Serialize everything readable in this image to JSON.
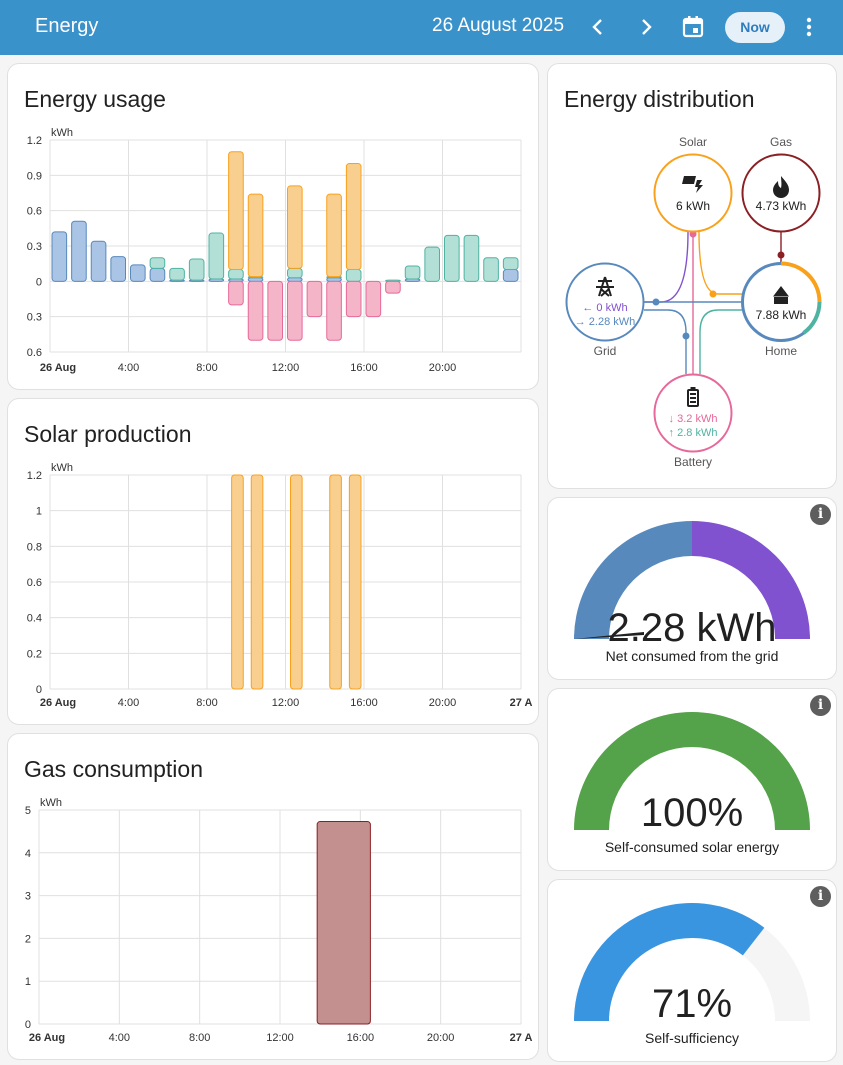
{
  "header": {
    "title": "Energy",
    "date": "26 August 2025",
    "now_label": "Now",
    "icons": [
      "chevron-left-icon",
      "chevron-right-icon",
      "calendar-icon",
      "more-vert-icon"
    ]
  },
  "energy_usage": {
    "title": "Energy usage",
    "unit": "kWh",
    "y_ticks": [
      "1.2",
      "0.9",
      "0.6",
      "0.3",
      "0",
      "0.3",
      "0.6"
    ],
    "x_ticks": [
      "26 Aug",
      "4:00",
      "8:00",
      "12:00",
      "16:00",
      "20:00"
    ]
  },
  "solar_production": {
    "title": "Solar production",
    "unit": "kWh",
    "y_ticks": [
      "1.2",
      "1",
      "0.8",
      "0.6",
      "0.4",
      "0.2",
      "0"
    ],
    "x_ticks": [
      "26 Aug",
      "4:00",
      "8:00",
      "12:00",
      "16:00",
      "20:00",
      "27 A"
    ]
  },
  "gas_consumption": {
    "title": "Gas consumption",
    "unit": "kWh",
    "y_ticks": [
      "5",
      "4",
      "3",
      "2",
      "1",
      "0"
    ],
    "x_ticks": [
      "26 Aug",
      "4:00",
      "8:00",
      "12:00",
      "16:00",
      "20:00",
      "27 A"
    ]
  },
  "distribution": {
    "title": "Energy distribution",
    "solar": {
      "label": "Solar",
      "value": "6 kWh"
    },
    "gas": {
      "label": "Gas",
      "value": "4.73 kWh"
    },
    "grid": {
      "label": "Grid",
      "in": "← 0 kWh",
      "out": "→ 2.28 kWh"
    },
    "home": {
      "label": "Home",
      "value": "7.88 kWh"
    },
    "battery": {
      "label": "Battery",
      "in": "↓ 3.2 kWh",
      "out": "↑ 2.8 kWh"
    }
  },
  "gauges": {
    "grid": {
      "value": "2.28 kWh",
      "label": "Net consumed from the grid"
    },
    "solar": {
      "value": "100%",
      "label": "Self-consumed solar energy",
      "fraction": 1.0
    },
    "self_sufficiency": {
      "value": "71%",
      "label": "Self-sufficiency",
      "fraction": 0.71
    }
  },
  "colors": {
    "header": "#3a92cb",
    "grid_consumption": "#a9c4e4",
    "solar": "#f9cf8f",
    "battery_out": "#b2e0d6",
    "battery_in": "#f4b5c8",
    "gas": "#c48f8f",
    "gauge_green": "#54a249",
    "gauge_blue": "#3a95e1",
    "gauge_purple": "#8152cf",
    "gauge_steel": "#5889bd"
  },
  "chart_data": [
    {
      "type": "bar",
      "title": "Energy usage",
      "ylabel": "kWh",
      "categories": [
        "0:00",
        "1:00",
        "2:00",
        "3:00",
        "4:00",
        "5:00",
        "6:00",
        "7:00",
        "8:00",
        "9:00",
        "10:00",
        "11:00",
        "12:00",
        "13:00",
        "14:00",
        "15:00",
        "16:00",
        "17:00",
        "18:00",
        "19:00",
        "20:00",
        "21:00",
        "22:00",
        "23:00"
      ],
      "series": [
        {
          "values": [
            0.42,
            0.51,
            0.34,
            0.21,
            0.14,
            0.11,
            0.01,
            0.01,
            0.02,
            0.02,
            0.03,
            0,
            0.03,
            0,
            0.03,
            0,
            0,
            0,
            0.02,
            0,
            0,
            0,
            0,
            0.1
          ]
        },
        {
          "values": [
            0,
            0,
            0,
            0,
            0,
            0.09,
            0.1,
            0.18,
            0.39,
            0.08,
            0.01,
            0,
            0.08,
            0,
            0.01,
            0.1,
            0,
            0.01,
            0.11,
            0.29,
            0.39,
            0.39,
            0.2,
            0.1
          ]
        },
        {
          "values": [
            0,
            0,
            0,
            0,
            0,
            0,
            0,
            0,
            0,
            1.0,
            0.7,
            0,
            0.7,
            0,
            0.7,
            0.9,
            0,
            0,
            0,
            0,
            0,
            0,
            0,
            0
          ]
        },
        {
          "values": [
            0,
            0,
            0,
            0,
            0,
            0,
            0,
            0,
            0,
            0.2,
            0.5,
            0.5,
            0.5,
            0.3,
            0.5,
            0.3,
            0.3,
            0.1,
            0,
            0,
            0,
            0,
            0,
            0
          ]
        }
      ],
      "ylim": [
        -0.6,
        1.2
      ]
    },
    {
      "type": "bar",
      "title": "Solar production",
      "ylabel": "kWh",
      "categories": [
        "0:00",
        "1:00",
        "2:00",
        "3:00",
        "4:00",
        "5:00",
        "6:00",
        "7:00",
        "8:00",
        "9:00",
        "10:00",
        "11:00",
        "12:00",
        "13:00",
        "14:00",
        "15:00",
        "16:00",
        "17:00",
        "18:00",
        "19:00",
        "20:00",
        "21:00",
        "22:00",
        "23:00"
      ],
      "values": [
        0,
        0,
        0,
        0,
        0,
        0,
        0,
        0,
        0,
        1.2,
        1.2,
        0,
        1.2,
        0,
        1.2,
        1.2,
        0,
        0,
        0,
        0,
        0,
        0,
        0,
        0
      ],
      "ylim": [
        0,
        1.2
      ]
    },
    {
      "type": "bar",
      "title": "Gas consumption",
      "ylabel": "kWh",
      "categories": [
        "14:00"
      ],
      "values": [
        4.73
      ],
      "ylim": [
        0,
        5
      ]
    }
  ]
}
